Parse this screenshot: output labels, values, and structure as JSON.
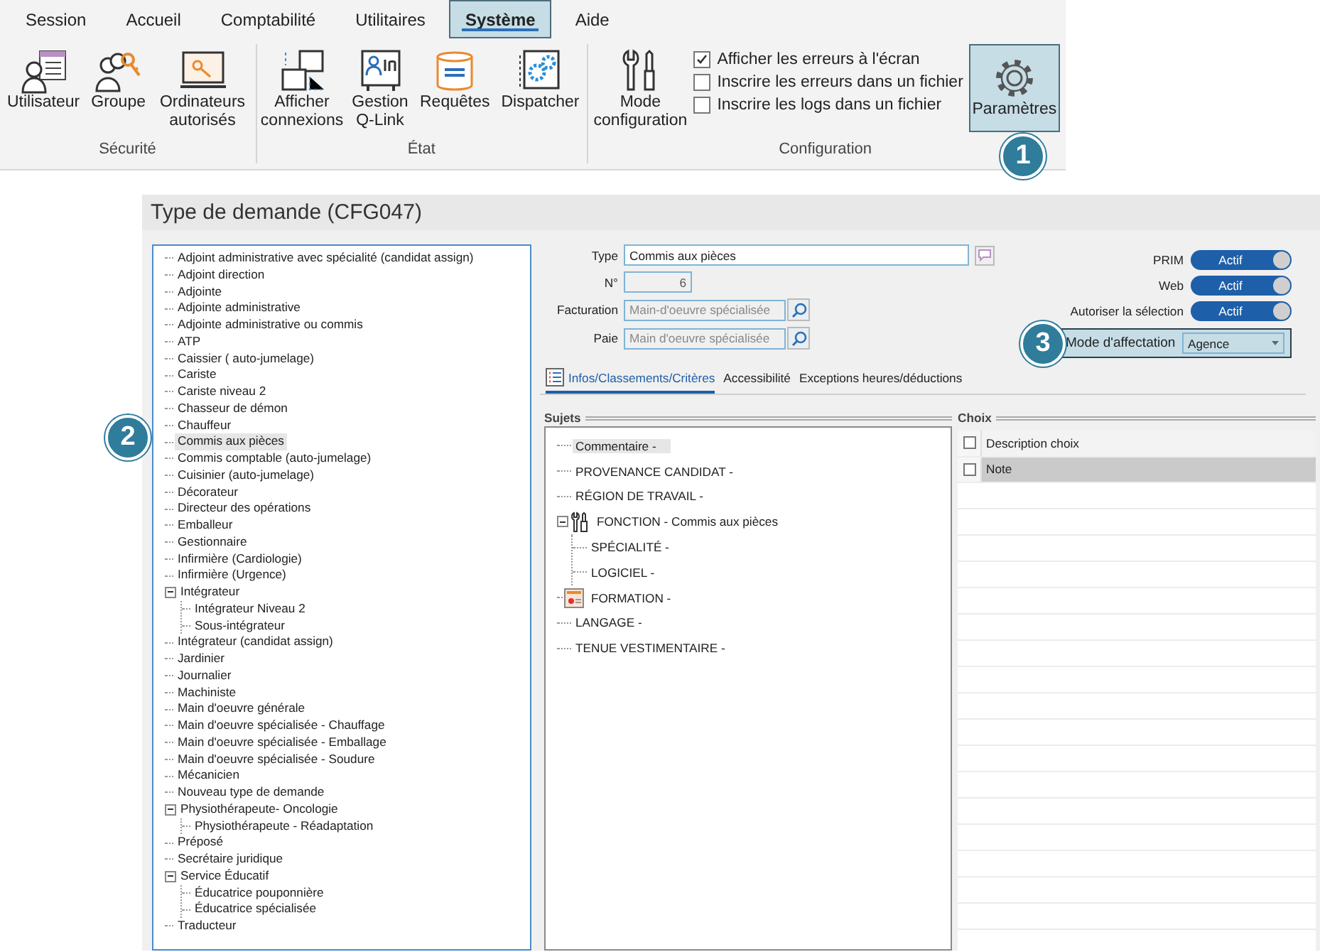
{
  "ribbon": {
    "tabs": [
      {
        "label": "Session",
        "selected": false
      },
      {
        "label": "Accueil",
        "selected": false
      },
      {
        "label": "Comptabilité",
        "selected": false
      },
      {
        "label": "Utilitaires",
        "selected": false
      },
      {
        "label": "Système",
        "selected": true
      },
      {
        "label": "Aide",
        "selected": false
      }
    ],
    "groups": [
      {
        "label": "Sécurité",
        "buttons": [
          {
            "label": "Utilisateur",
            "kind": "user",
            "selected": false
          },
          {
            "label": "Groupe",
            "kind": "group",
            "selected": false
          },
          {
            "label": "Ordinateurs autorisés",
            "kind": "computer",
            "selected": false
          }
        ]
      },
      {
        "label": "État",
        "buttons": [
          {
            "label": "Afficher connexions",
            "kind": "connections",
            "selected": false
          },
          {
            "label": "Gestion Q-Link",
            "kind": "qlink",
            "selected": false
          },
          {
            "label": "Requêtes",
            "kind": "sql",
            "selected": false
          },
          {
            "label": "Dispatcher",
            "kind": "dispatcher",
            "selected": false
          }
        ]
      },
      {
        "label": "Configuration",
        "buttons": [
          {
            "label": "Mode configuration",
            "kind": "tools",
            "selected": false
          }
        ],
        "checkboxes": [
          {
            "label": "Afficher les erreurs à l'écran",
            "checked": true
          },
          {
            "label": "Inscrire les erreurs dans un fichier",
            "checked": false
          },
          {
            "label": "Inscrire les logs dans un fichier",
            "checked": false
          }
        ],
        "end_buttons": [
          {
            "label": "Paramètres",
            "kind": "gear",
            "selected": true
          }
        ]
      }
    ]
  },
  "callouts": [
    "1",
    "2",
    "3"
  ],
  "window": {
    "title": "Type de demande (CFG047)",
    "tree": [
      {
        "label": "Adjoint administrative avec spécialité (candidat assign)",
        "selected": false
      },
      {
        "label": "Adjoint direction",
        "selected": false
      },
      {
        "label": "Adjointe",
        "selected": false
      },
      {
        "label": "Adjointe administrative",
        "selected": false
      },
      {
        "label": "Adjointe administrative ou commis",
        "selected": false
      },
      {
        "label": "ATP",
        "selected": false
      },
      {
        "label": "Caissier ( auto-jumelage)",
        "selected": false
      },
      {
        "label": "Cariste",
        "selected": false
      },
      {
        "label": "Cariste niveau 2",
        "selected": false
      },
      {
        "label": "Chasseur de démon",
        "selected": false
      },
      {
        "label": "Chauffeur",
        "selected": false
      },
      {
        "label": "Commis aux pièces",
        "selected": true
      },
      {
        "label": "Commis comptable (auto-jumelage)",
        "selected": false
      },
      {
        "label": "Cuisinier (auto-jumelage)",
        "selected": false
      },
      {
        "label": "Décorateur",
        "selected": false
      },
      {
        "label": "Directeur des opérations",
        "selected": false
      },
      {
        "label": "Emballeur",
        "selected": false
      },
      {
        "label": "Gestionnaire",
        "selected": false
      },
      {
        "label": "Infirmière (Cardiologie)",
        "selected": false
      },
      {
        "label": "Infirmière (Urgence)",
        "selected": false
      },
      {
        "label": "Intégrateur",
        "selected": false,
        "expanded": true,
        "children": [
          {
            "label": "Intégrateur Niveau 2",
            "selected": false
          },
          {
            "label": "Sous-intégrateur",
            "selected": false
          }
        ]
      },
      {
        "label": "Intégrateur (candidat assign)",
        "selected": false
      },
      {
        "label": "Jardinier",
        "selected": false
      },
      {
        "label": "Journalier",
        "selected": false
      },
      {
        "label": "Machiniste",
        "selected": false
      },
      {
        "label": "Main d'oeuvre générale",
        "selected": false
      },
      {
        "label": "Main d'oeuvre spécialisée - Chauffage",
        "selected": false
      },
      {
        "label": "Main d'oeuvre spécialisée - Emballage",
        "selected": false
      },
      {
        "label": "Main d'oeuvre spécialisée - Soudure",
        "selected": false
      },
      {
        "label": "Mécanicien",
        "selected": false
      },
      {
        "label": "Nouveau type de demande",
        "selected": false
      },
      {
        "label": "Physiothérapeute- Oncologie",
        "selected": false,
        "expanded": true,
        "children": [
          {
            "label": "Physiothérapeute - Réadaptation",
            "selected": false
          }
        ]
      },
      {
        "label": "Préposé",
        "selected": false
      },
      {
        "label": "Secrétaire juridique",
        "selected": false
      },
      {
        "label": "Service Éducatif",
        "selected": false,
        "expanded": true,
        "children": [
          {
            "label": "Éducatrice pouponnière",
            "selected": false
          },
          {
            "label": "Éducatrice spécialisée",
            "selected": false
          }
        ]
      },
      {
        "label": "Traducteur",
        "selected": false
      }
    ],
    "fields": [
      {
        "label": "Type",
        "value": "Commis aux pièces",
        "kind": "text"
      },
      {
        "label": "N°",
        "value": "6",
        "kind": "number"
      },
      {
        "label": "Facturation",
        "value": "Main-d'oeuvre spécialisée",
        "kind": "lookup"
      },
      {
        "label": "Paie",
        "value": "Main d'oeuvre spécialisée",
        "kind": "lookup"
      }
    ],
    "toggles": [
      {
        "label": "PRIM",
        "on": true,
        "text": "Actif"
      },
      {
        "label": "Web",
        "on": true,
        "text": "Actif"
      },
      {
        "label": "Autoriser la sélection",
        "on": true,
        "text": "Actif"
      }
    ],
    "assignment": {
      "label": "Mode d'affectation",
      "value": "Agence"
    },
    "tabs": [
      {
        "label": "Infos/Classements/Critères",
        "selected": true
      },
      {
        "label": "Accessibilité",
        "selected": false
      },
      {
        "label": "Exceptions heures/déductions",
        "selected": false
      }
    ],
    "subjects": {
      "title": "Sujets",
      "items": [
        {
          "label": "Commentaire -",
          "kind": "plain",
          "selected": true
        },
        {
          "label": "PROVENANCE CANDIDAT -",
          "kind": "plain",
          "selected": false
        },
        {
          "label": "RÉGION DE TRAVAIL -",
          "kind": "plain",
          "selected": false
        },
        {
          "label": "FONCTION - Commis aux pièces",
          "kind": "function",
          "selected": false,
          "expanded": true,
          "children": [
            {
              "label": "SPÉCIALITÉ -",
              "kind": "plain",
              "selected": false
            },
            {
              "label": "LOGICIEL -",
              "kind": "plain",
              "selected": false
            }
          ]
        },
        {
          "label": "FORMATION -",
          "kind": "training",
          "selected": false
        },
        {
          "label": "LANGAGE -",
          "kind": "plain",
          "selected": false
        },
        {
          "label": "TENUE VESTIMENTAIRE -",
          "kind": "plain",
          "selected": false
        }
      ]
    },
    "choices": {
      "title": "Choix",
      "header": {
        "label": "Description choix",
        "checked": false
      },
      "rows": [
        {
          "label": "Note",
          "checked": false,
          "selected": true
        }
      ]
    }
  }
}
